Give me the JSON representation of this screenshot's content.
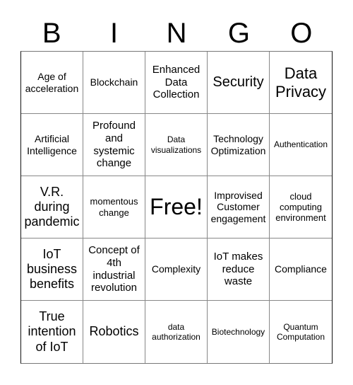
{
  "header": [
    "B",
    "I",
    "N",
    "G",
    "O"
  ],
  "cells": [
    "Age of acceleration",
    "Blockchain",
    "Enhanced Data Collection",
    "Security",
    "Data Privacy",
    "Artificial Intelligence",
    "Profound and systemic change",
    "Data visualizations",
    "Technology Optimization",
    "Authentication",
    "V.R. during pandemic",
    "momentous change",
    "Free!",
    "Improvised Customer engagement",
    "cloud computing environment",
    "IoT business benefits",
    "Concept of 4th industrial revolution",
    "Complexity",
    "IoT makes reduce waste",
    "Compliance",
    "True intention of IoT",
    "Robotics",
    "data authorization",
    "Biotechnology",
    "Quantum Computation"
  ]
}
